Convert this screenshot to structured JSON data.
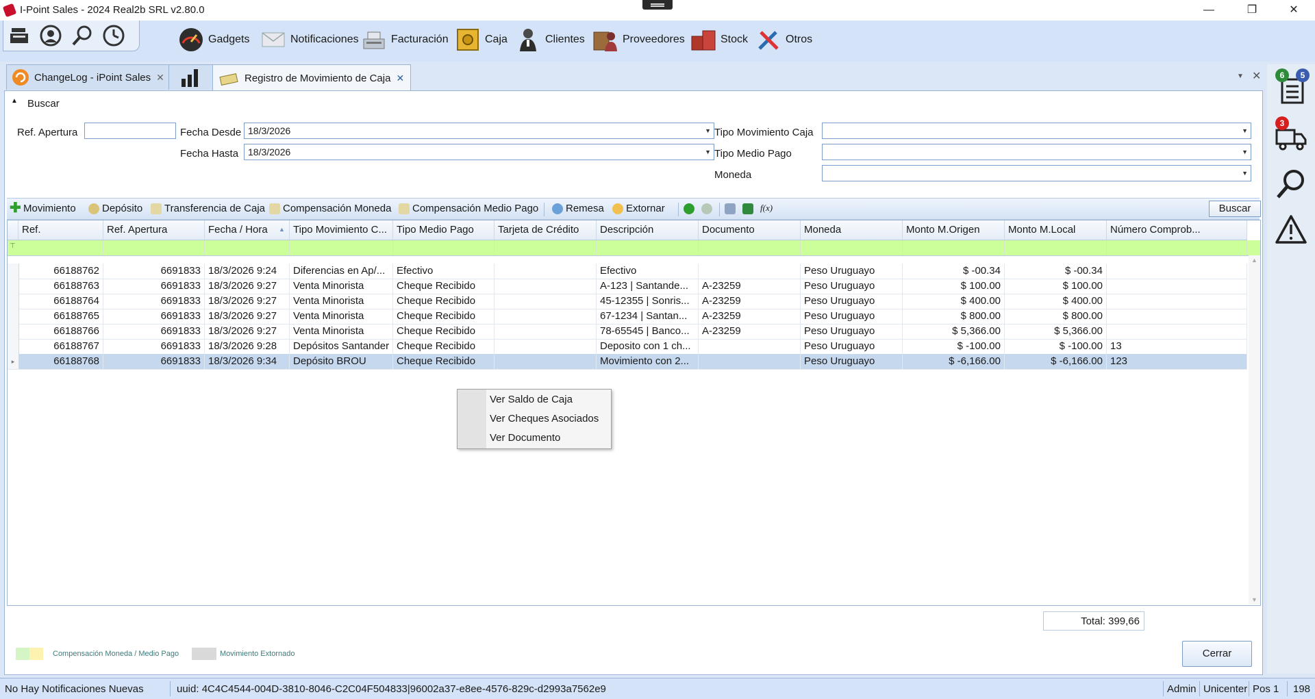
{
  "window": {
    "title": "I-Point Sales  - 2024 Real2b SRL v2.80.0",
    "minimize": "—",
    "restore": "❐",
    "close": "✕"
  },
  "menu": [
    {
      "label": "Gadgets",
      "icon": "gauge-icon"
    },
    {
      "label": "Notificaciones",
      "icon": "envelope-icon"
    },
    {
      "label": "Facturación",
      "icon": "cash-register-icon"
    },
    {
      "label": "Caja",
      "icon": "safe-icon"
    },
    {
      "label": "Clientes",
      "icon": "person-icon"
    },
    {
      "label": "Proveedores",
      "icon": "supplier-icon"
    },
    {
      "label": "Stock",
      "icon": "boxes-icon"
    },
    {
      "label": "Otros",
      "icon": "tools-icon"
    }
  ],
  "tabs": [
    {
      "label": "ChangeLog - iPoint Sales",
      "close": "✕"
    },
    {
      "label": "",
      "close": ""
    },
    {
      "label": "Registro de Movimiento de Caja",
      "close": "✕"
    }
  ],
  "sidepanel": {
    "badge_tasks_green": "6",
    "badge_tasks_blue": "5",
    "badge_delivery": "3"
  },
  "filters": {
    "section_label": "Buscar",
    "ref_apertura_label": "Ref. Apertura",
    "ref_apertura_value": "",
    "fecha_desde_label": "Fecha Desde",
    "fecha_desde_value": "18/3/2026",
    "fecha_hasta_label": "Fecha Hasta",
    "fecha_hasta_value": "18/3/2026",
    "tipo_mov_label": "Tipo Movimiento Caja",
    "tipo_mov_value": "",
    "tipo_medio_label": "Tipo Medio Pago",
    "tipo_medio_value": "",
    "moneda_label": "Moneda",
    "moneda_value": ""
  },
  "toolbar": {
    "movimiento": "Movimiento",
    "deposito": "Depósito",
    "transferencia": "Transferencia de Caja",
    "comp_moneda": "Compensación Moneda",
    "comp_medio": "Compensación Medio Pago",
    "remesa": "Remesa",
    "extornar": "Extornar",
    "fx": "f(x)",
    "buscar": "Buscar"
  },
  "grid": {
    "columns": [
      "Ref.",
      "Ref. Apertura",
      "Fecha / Hora",
      "Tipo Movimiento C...",
      "Tipo Medio Pago",
      "Tarjeta de Crédito",
      "Descripción",
      "Documento",
      "Moneda",
      "Monto M.Origen",
      "Monto M.Local",
      "Número Comprob..."
    ],
    "rows": [
      [
        "66188762",
        "6691833",
        "18/3/2026 9:24",
        "Diferencias en Ap/...",
        "Efectivo",
        "",
        "Efectivo",
        "",
        "Peso Uruguayo",
        "$ -00.34",
        "$ -00.34",
        ""
      ],
      [
        "66188763",
        "6691833",
        "18/3/2026 9:27",
        "Venta Minorista",
        "Cheque Recibido",
        "",
        "A-123  |  Santande...",
        "A-23259",
        "Peso Uruguayo",
        "$ 100.00",
        "$ 100.00",
        ""
      ],
      [
        "66188764",
        "6691833",
        "18/3/2026 9:27",
        "Venta Minorista",
        "Cheque Recibido",
        "",
        "45-12355  |  Sonris...",
        "A-23259",
        "Peso Uruguayo",
        "$ 400.00",
        "$ 400.00",
        ""
      ],
      [
        "66188765",
        "6691833",
        "18/3/2026 9:27",
        "Venta Minorista",
        "Cheque Recibido",
        "",
        "67-1234  |  Santan...",
        "A-23259",
        "Peso Uruguayo",
        "$ 800.00",
        "$ 800.00",
        ""
      ],
      [
        "66188766",
        "6691833",
        "18/3/2026 9:27",
        "Venta Minorista",
        "Cheque Recibido",
        "",
        "78-65545  |  Banco...",
        "A-23259",
        "Peso Uruguayo",
        "$ 5,366.00",
        "$ 5,366.00",
        ""
      ],
      [
        "66188767",
        "6691833",
        "18/3/2026 9:28",
        "Depósitos Santander",
        "Cheque Recibido",
        "",
        "Deposito con 1 ch...",
        "",
        "Peso Uruguayo",
        "$ -100.00",
        "$ -100.00",
        "13"
      ],
      [
        "66188768",
        "6691833",
        "18/3/2026 9:34",
        "Depósito BROU",
        "Cheque Recibido",
        "",
        "Movimiento con 2...",
        "",
        "Peso Uruguayo",
        "$ -6,166.00",
        "$ -6,166.00",
        "123"
      ]
    ],
    "selected_row": 6,
    "total": "Total: 399,66"
  },
  "context_menu": [
    "Ver Saldo de Caja",
    "Ver Cheques Asociados",
    "Ver Documento"
  ],
  "legend": {
    "compensacion": "Compensación Moneda / Medio Pago",
    "extornado": "Movimiento Extornado"
  },
  "cerrar": "Cerrar",
  "status": {
    "notifications": "No Hay Notificaciones Nuevas",
    "uuid": "uuid: 4C4C4544-004D-3810-8046-C2C04F504833|96002a37-e8ee-4576-829c-d2993a7562e9",
    "user": "Admin",
    "company": "Unicenter",
    "pos": "Pos 1",
    "num": "198"
  },
  "colors": {
    "filter_row": "#ccff99",
    "selected_row": "#c6d8ee",
    "legend_green": "#d6f5c4",
    "legend_yellow": "#fdf2b0",
    "legend_gray": "#d9d9d9"
  }
}
